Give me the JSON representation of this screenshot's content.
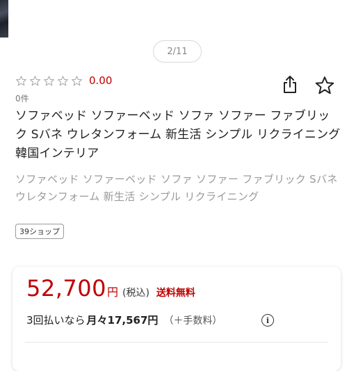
{
  "gallery": {
    "page_indicator": "2/11"
  },
  "rating": {
    "score": "0.00",
    "review_count": "0件",
    "max_stars": 5
  },
  "product": {
    "title": "ソファベッド ソファーベッド ソファ ソファー ファブリック Sバネ ウレタンフォーム 新生活 シンプル リクライニング 韓国インテリア",
    "subtitle": "ソファベッド ソファーベッド ソファ ソファー ファブリック Sバネ ウレタンフォーム 新生活 シンプル リクライニング"
  },
  "shop": {
    "badge_label": "39ショップ"
  },
  "price": {
    "amount": "52,700",
    "currency": "円",
    "tax_label": "(税込)",
    "shipping_label": "送料無料",
    "installment_prefix": "3回払いなら",
    "installment_amount": "月々17,567円",
    "installment_fee": "（＋手数料）",
    "info_glyph": "i"
  },
  "icons": {
    "share": "share-icon",
    "favorite": "star-outline-icon",
    "info": "info-circle-icon"
  },
  "colors": {
    "accent": "#bf0000",
    "muted": "#9a9a9a",
    "star_outline": "#aaaaaa"
  }
}
